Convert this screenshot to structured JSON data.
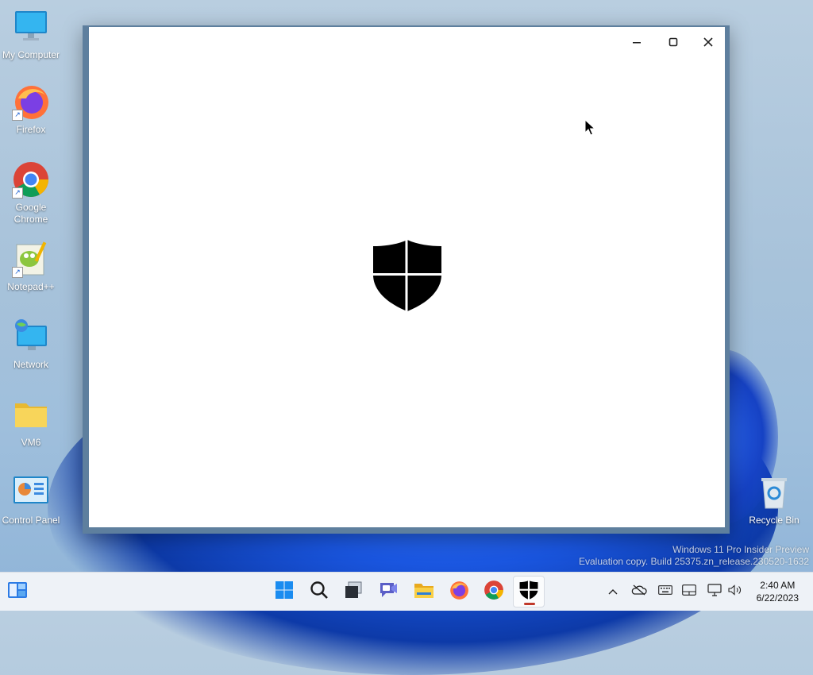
{
  "desktop": {
    "icons": [
      {
        "label": "My Computer",
        "icon": "monitor-icon"
      },
      {
        "label": "Firefox",
        "icon": "firefox-icon"
      },
      {
        "label": "Google Chrome",
        "icon": "chrome-icon"
      },
      {
        "label": "Notepad++",
        "icon": "notepadpp-icon"
      },
      {
        "label": "Network",
        "icon": "network-icon"
      },
      {
        "label": "VM6",
        "icon": "folder-icon"
      },
      {
        "label": "Control Panel",
        "icon": "control-panel-icon"
      }
    ],
    "recycle_bin": {
      "label": "Recycle Bin",
      "icon": "recycle-bin-icon"
    }
  },
  "window": {
    "center_icon": "windows-security-shield-icon",
    "controls": {
      "minimize": "minimize-icon",
      "maximize": "maximize-icon",
      "close": "close-icon"
    }
  },
  "watermark": {
    "line1": "Windows 11 Pro Insider Preview",
    "line2": "Evaluation copy. Build 25375.zn_release.230520-1632"
  },
  "taskbar": {
    "items": [
      "widgets-icon",
      "start-icon",
      "search-icon",
      "task-view-icon",
      "chat-icon",
      "file-explorer-icon",
      "firefox-icon",
      "chrome-icon",
      "windows-security-icon"
    ],
    "active_item": "windows-security-icon",
    "tray": [
      "chevron-up-icon",
      "onedrive-offline-icon",
      "keyboard-icon",
      "touchpad-icon",
      "network-icon",
      "volume-icon"
    ],
    "clock": {
      "time": "2:40 AM",
      "date": "6/22/2023"
    }
  },
  "colors": {
    "taskbar_bg": "#eef2f7",
    "window_frame": "#5e7f9e",
    "accent_underline": "#c0392b"
  }
}
